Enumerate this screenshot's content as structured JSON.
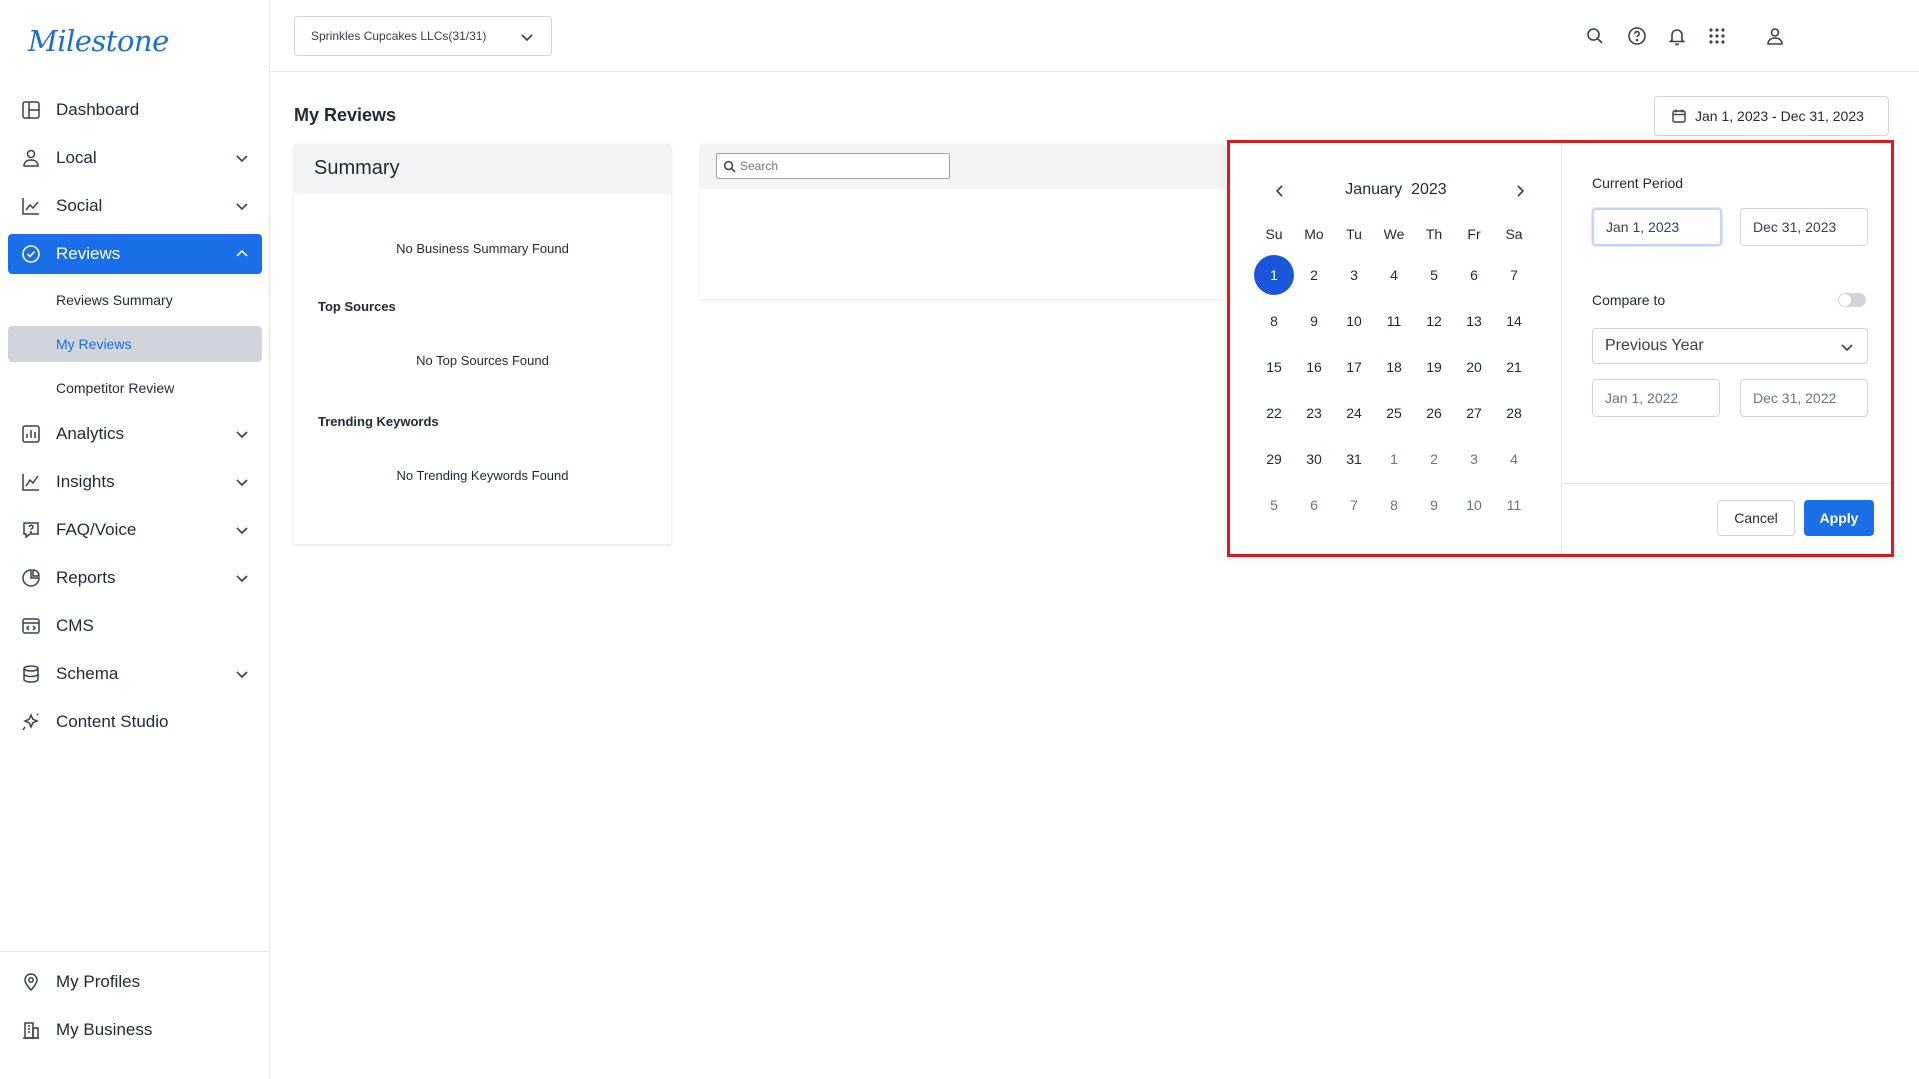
{
  "app": {
    "logo_text": "Milestone"
  },
  "sidebar": {
    "items": [
      {
        "label": "Dashboard",
        "icon": "layout-icon",
        "has_chevron": false
      },
      {
        "label": "Local",
        "icon": "location-user-icon",
        "has_chevron": true
      },
      {
        "label": "Social",
        "icon": "line-chart-icon",
        "has_chevron": true
      },
      {
        "label": "Reviews",
        "icon": "check-circle-icon",
        "has_chevron": true,
        "active": true
      }
    ],
    "reviews_sub": [
      "Reviews Summary",
      "My Reviews",
      "Competitor Review"
    ],
    "items_after": [
      {
        "label": "Analytics",
        "icon": "bar-chart-icon"
      },
      {
        "label": "Insights",
        "icon": "trend-icon"
      },
      {
        "label": "FAQ/Voice",
        "icon": "question-chat-icon"
      },
      {
        "label": "Reports",
        "icon": "pie-chart-icon"
      },
      {
        "label": "CMS",
        "icon": "code-window-icon"
      },
      {
        "label": "Schema",
        "icon": "database-icon"
      },
      {
        "label": "Content Studio",
        "icon": "sparkle-icon"
      }
    ],
    "bottom": [
      {
        "label": "My Profiles",
        "icon": "map-pin-icon"
      },
      {
        "label": "My Business",
        "icon": "building-icon"
      }
    ]
  },
  "topbar": {
    "business_select": "Sprinkles Cupcakes LLCs(31/31)",
    "icons": [
      "search-icon",
      "help-icon",
      "bell-icon",
      "apps-grid-icon",
      "user-icon"
    ]
  },
  "main": {
    "title": "My Reviews",
    "date_range": "Jan 1, 2023 - Dec 31, 2023",
    "summary": {
      "title": "Summary",
      "no_summary": "No Business Summary Found",
      "top_sources_label": "Top Sources",
      "no_sources": "No Top Sources Found",
      "trending_label": "Trending Keywords",
      "no_keywords": "No Trending Keywords Found"
    },
    "search_placeholder": "Search"
  },
  "picker": {
    "month": "January",
    "year": "2023",
    "weekdays": [
      "Su",
      "Mo",
      "Tu",
      "We",
      "Th",
      "Fr",
      "Sa"
    ],
    "weeks": [
      [
        1,
        2,
        3,
        4,
        5,
        6,
        7
      ],
      [
        8,
        9,
        10,
        11,
        12,
        13,
        14
      ],
      [
        15,
        16,
        17,
        18,
        19,
        20,
        21
      ],
      [
        22,
        23,
        24,
        25,
        26,
        27,
        28
      ],
      [
        29,
        30,
        31,
        1,
        2,
        3,
        4
      ],
      [
        5,
        6,
        7,
        8,
        9,
        10,
        11
      ]
    ],
    "selected_day": 1,
    "current_period_label": "Current Period",
    "current_start": "Jan 1, 2023",
    "current_end": "Dec 31, 2023",
    "compare_label": "Compare to",
    "compare_enabled": false,
    "compare_option": "Previous Year",
    "compare_start": "Jan 1, 2022",
    "compare_end": "Dec 31, 2022",
    "cancel_label": "Cancel",
    "apply_label": "Apply"
  },
  "colors": {
    "accent": "#1a6fe8",
    "highlight_border": "#e8141c",
    "selected_day": "#1a56db"
  }
}
